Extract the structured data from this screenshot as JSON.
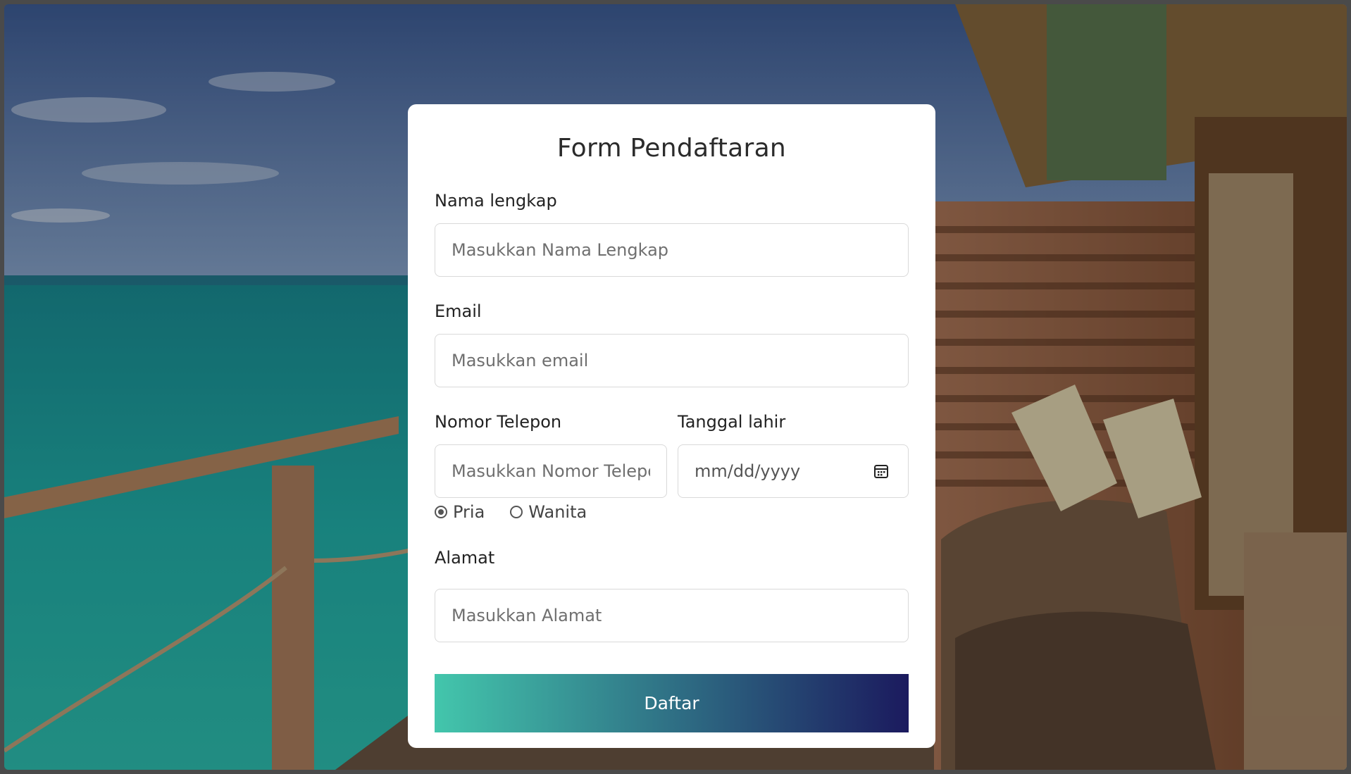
{
  "form": {
    "title": "Form Pendaftaran",
    "name": {
      "label": "Nama lengkap",
      "placeholder": "Masukkan Nama Lengkap"
    },
    "email": {
      "label": "Email",
      "placeholder": "Masukkan email"
    },
    "phone": {
      "label": "Nomor Telepon",
      "placeholder": "Masukkan Nomor Telepon"
    },
    "birthdate": {
      "label": "Tanggal lahir",
      "placeholder": "mm/dd/yyyy"
    },
    "gender": {
      "options": [
        "Pria",
        "Wanita"
      ],
      "selected": "Pria"
    },
    "address": {
      "label": "Alamat",
      "placeholder": "Masukkan Alamat"
    },
    "submit_label": "Daftar"
  },
  "colors": {
    "gradient_start": "#43c6ac",
    "gradient_end": "#1b1a5e",
    "card_bg": "#ffffff"
  },
  "icons": {
    "date_picker": "calendar-icon"
  }
}
